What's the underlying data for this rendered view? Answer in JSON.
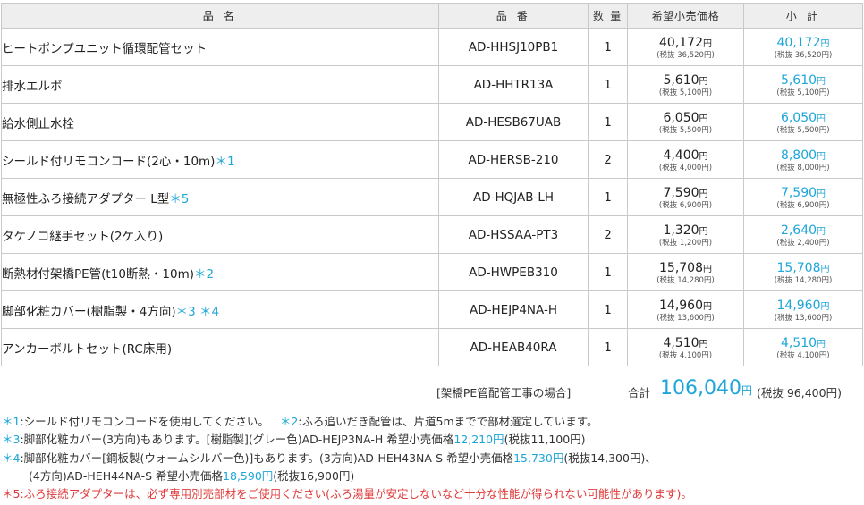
{
  "header": {
    "name": "品 名",
    "code": "品 番",
    "qty": "数 量",
    "price": "希望小売価格",
    "subtotal": "小 計"
  },
  "rows": [
    {
      "name": "ヒートポンプユニット循環配管セット",
      "mark": "",
      "code": "AD-HHSJ10PB1",
      "qty": "1",
      "price": "40,172",
      "price_tax": "(税抜 36,520円)",
      "subtotal": "40,172",
      "subtotal_tax": "(税抜 36,520円)"
    },
    {
      "name": "排水エルボ",
      "mark": "",
      "code": "AD-HHTR13A",
      "qty": "1",
      "price": "5,610",
      "price_tax": "(税抜 5,100円)",
      "subtotal": "5,610",
      "subtotal_tax": "(税抜 5,100円)"
    },
    {
      "name": "給水側止水栓",
      "mark": "",
      "code": "AD-HESB67UAB",
      "qty": "1",
      "price": "6,050",
      "price_tax": "(税抜 5,500円)",
      "subtotal": "6,050",
      "subtotal_tax": "(税抜 5,500円)"
    },
    {
      "name": "シールド付リモコンコード(2心・10m)",
      "mark": "＊1",
      "code": "AD-HERSB-210",
      "qty": "2",
      "price": "4,400",
      "price_tax": "(税抜 4,000円)",
      "subtotal": "8,800",
      "subtotal_tax": "(税抜 8,000円)"
    },
    {
      "name": "無極性ふろ接続アダプター L型",
      "mark": "＊5",
      "code": "AD-HQJAB-LH",
      "qty": "1",
      "price": "7,590",
      "price_tax": "(税抜 6,900円)",
      "subtotal": "7,590",
      "subtotal_tax": "(税抜 6,900円)"
    },
    {
      "name": "タケノコ継手セット(2ケ入り)",
      "mark": "",
      "code": "AD-HSSAA-PT3",
      "qty": "2",
      "price": "1,320",
      "price_tax": "(税抜 1,200円)",
      "subtotal": "2,640",
      "subtotal_tax": "(税抜 2,400円)"
    },
    {
      "name": "断熱材付架橋PE管(t10断熱・10m)",
      "mark": "＊2",
      "code": "AD-HWPEB310",
      "qty": "1",
      "price": "15,708",
      "price_tax": "(税抜 14,280円)",
      "subtotal": "15,708",
      "subtotal_tax": "(税抜 14,280円)"
    },
    {
      "name": "脚部化粧カバー(樹脂製・4方向)",
      "mark": "＊3 ＊4",
      "code": "AD-HEJP4NA-H",
      "qty": "1",
      "price": "14,960",
      "price_tax": "(税抜 13,600円)",
      "subtotal": "14,960",
      "subtotal_tax": "(税抜 13,600円)"
    },
    {
      "name": "アンカーボルトセット(RC床用)",
      "mark": "",
      "code": "AD-HEAB40RA",
      "qty": "1",
      "price": "4,510",
      "price_tax": "(税抜 4,100円)",
      "subtotal": "4,510",
      "subtotal_tax": "(税抜 4,100円)"
    }
  ],
  "yen": "円",
  "summary": {
    "context": "[架橋PE管配管工事の場合]",
    "total_label": "合計",
    "total_amount": "106,040",
    "total_yen": "円",
    "total_tax": "(税抜 96,400円)"
  },
  "notes": {
    "n1_mark": "＊1",
    "n1_text": ":シールド付リモコンコードを使用してください。",
    "n2_mark": "＊2",
    "n2_text": ":ふろ追いだき配管は、片道5mまでで部材選定しています。",
    "n3_mark": "＊3",
    "n3_text": ":脚部化粧カバー(3方向)もあります。[樹脂製](グレー色)AD-HEJP3NA-H 希望小売価格",
    "n3_price": "12,210円",
    "n3_tail": "(税抜11,100円)",
    "n4_mark": "＊4",
    "n4_text": ":脚部化粧カバー[鋼板製(ウォームシルバー色)]もあります。(3方向)AD-HEH43NA-S 希望小売価格",
    "n4_price": "15,730円",
    "n4_tail": "(税抜14,300円)、",
    "n4_cont": "(4方向)AD-HEH44NA-S 希望小売価格",
    "n4_cont_price": "18,590円",
    "n4_cont_tail": "(税抜16,900円)",
    "n5_text": "＊5:ふろ接続アダプターは、必ず専用別売部材をご使用ください(ふろ湯量が安定しないなど十分な性能が得られない可能性があります)。"
  },
  "colors": {
    "accent_blue": "#1ea6d8",
    "warning_red": "#e03a3a",
    "header_bg": "#eeeeee",
    "border": "#c9c9c9"
  }
}
